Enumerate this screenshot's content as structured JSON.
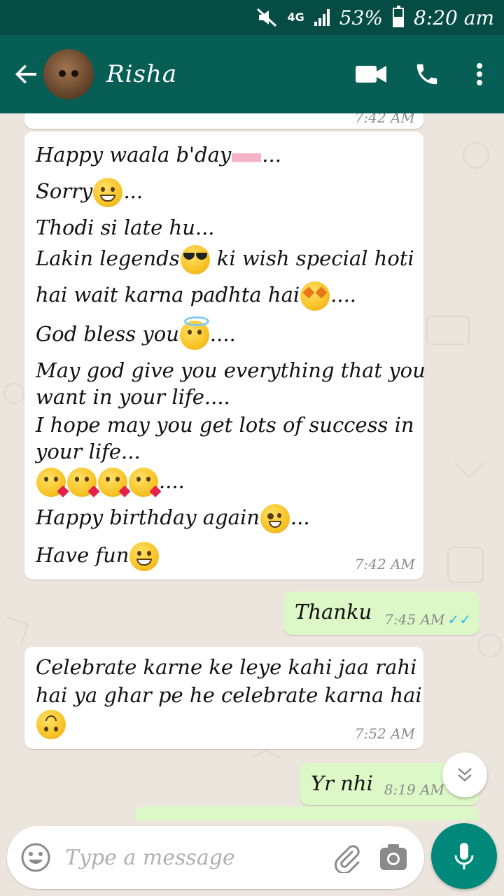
{
  "status_bar": {
    "network": "4G",
    "battery": "53%",
    "time": "8:20 am"
  },
  "header": {
    "contact_name": "Risha",
    "icons": [
      "back-arrow-icon",
      "video-call-icon",
      "phone-icon",
      "more-vert-icon"
    ]
  },
  "messages": [
    {
      "direction": "in",
      "lines": [
        "Happy waala b'day",
        "...",
        "Sorry",
        "...",
        "Thodi si late hu...",
        "Lakin legends",
        " ki wish special hoti",
        "hai wait karna padhta hai",
        "....",
        "God bless you",
        "....",
        "May god give you everything that you",
        "want in your life....",
        "I hope may you get lots of success in",
        "your life...",
        "....",
        "Happy birthday again",
        "...",
        "Have fun"
      ],
      "time": "7:42 AM"
    },
    {
      "direction": "out",
      "text": "Thanku",
      "time": "7:45 AM",
      "status": "read"
    },
    {
      "direction": "in",
      "lines": [
        "Celebrate karne ke leye kahi jaa rahi",
        "hai ya ghar pe he celebrate karna hai"
      ],
      "time": "7:52 AM"
    },
    {
      "direction": "out",
      "text": "Yr nhi",
      "time": "8:19 AM"
    }
  ],
  "previous_message": {
    "time": "7:42 AM"
  },
  "composer": {
    "placeholder": "Type a message"
  },
  "colors": {
    "status_bar": "#054d44",
    "app_bar": "#075e54",
    "chat_bg": "#ece5dd",
    "out_bubble": "#dcf8c6",
    "mic_button": "#00897b",
    "read_ticks": "#34b7f1"
  }
}
